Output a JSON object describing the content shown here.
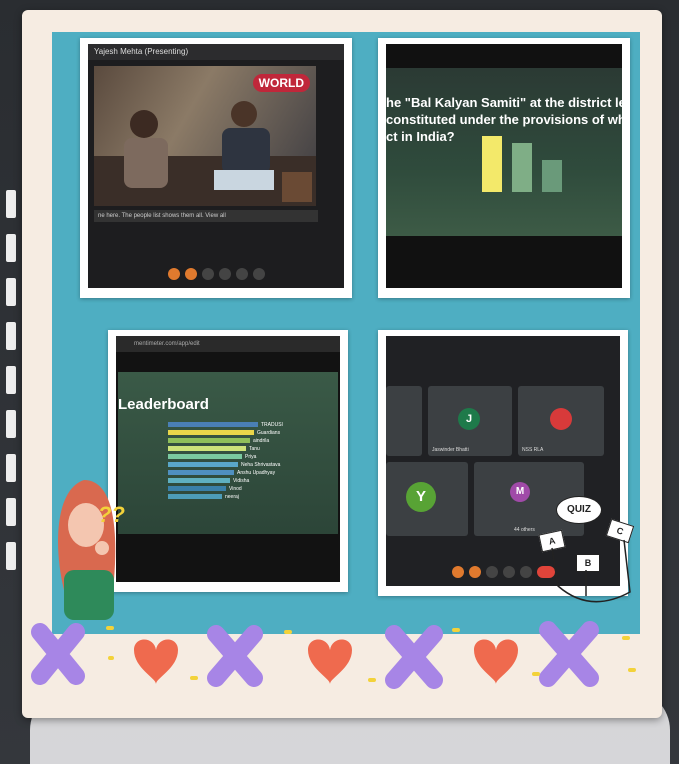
{
  "screens": {
    "top_left": {
      "title": "Yajesh Mehta (Presenting)",
      "caption": "ne here. The people list shows them all.   View all",
      "logo": "WORLD"
    },
    "top_right": {
      "question_line1": "he \"Bal Kalyan Samiti\" at the district lev",
      "question_line2": "constituted under the provisions of wh",
      "question_line3": "ct in India?",
      "bars": [
        {
          "color": "#f3e96a",
          "value": 0.8
        },
        {
          "color": "#7fae86",
          "value": 0.7
        },
        {
          "color": "#6a9a7a",
          "value": 0.45
        }
      ]
    },
    "bottom_left": {
      "url": "mentimeter.com/app/edit",
      "heading": "Leaderboard",
      "rows": [
        {
          "name": "TRADUSI",
          "color": "#4a7fb5"
        },
        {
          "name": "Guardians",
          "color": "#e9d64a"
        },
        {
          "name": "aindrila",
          "color": "#8fbf5a"
        },
        {
          "name": "Tanu",
          "color": "#cde37a"
        },
        {
          "name": "Priya",
          "color": "#7ac9a0"
        },
        {
          "name": "Neha Shrivastava",
          "color": "#5aa7c9"
        },
        {
          "name": "Anshu Upadhyay",
          "color": "#4f8fc0"
        },
        {
          "name": "Vidisha",
          "color": "#5fb0c0"
        },
        {
          "name": "Vinod",
          "color": "#3a80a8"
        },
        {
          "name": "neeraj",
          "color": "#4d9cb8"
        }
      ]
    },
    "bottom_right": {
      "participants": [
        {
          "initial": "J",
          "name": "Jaswinder Bhatti",
          "color": "#1e7a4a"
        },
        {
          "initial": "",
          "name": "NSS RLA",
          "color": "#d83a3a"
        },
        {
          "initial": "Y",
          "name": "",
          "color": "#58a335"
        },
        {
          "initial": "M",
          "name": "44 others",
          "color": "#a04aa8"
        }
      ]
    }
  },
  "stickers": {
    "question_marks": "??",
    "quiz_label": "QUIZ",
    "options": [
      "A",
      "B",
      "C"
    ]
  },
  "colors": {
    "background": "#2e3136",
    "frame": "#f6ece2",
    "teal": "#4eaec2"
  }
}
